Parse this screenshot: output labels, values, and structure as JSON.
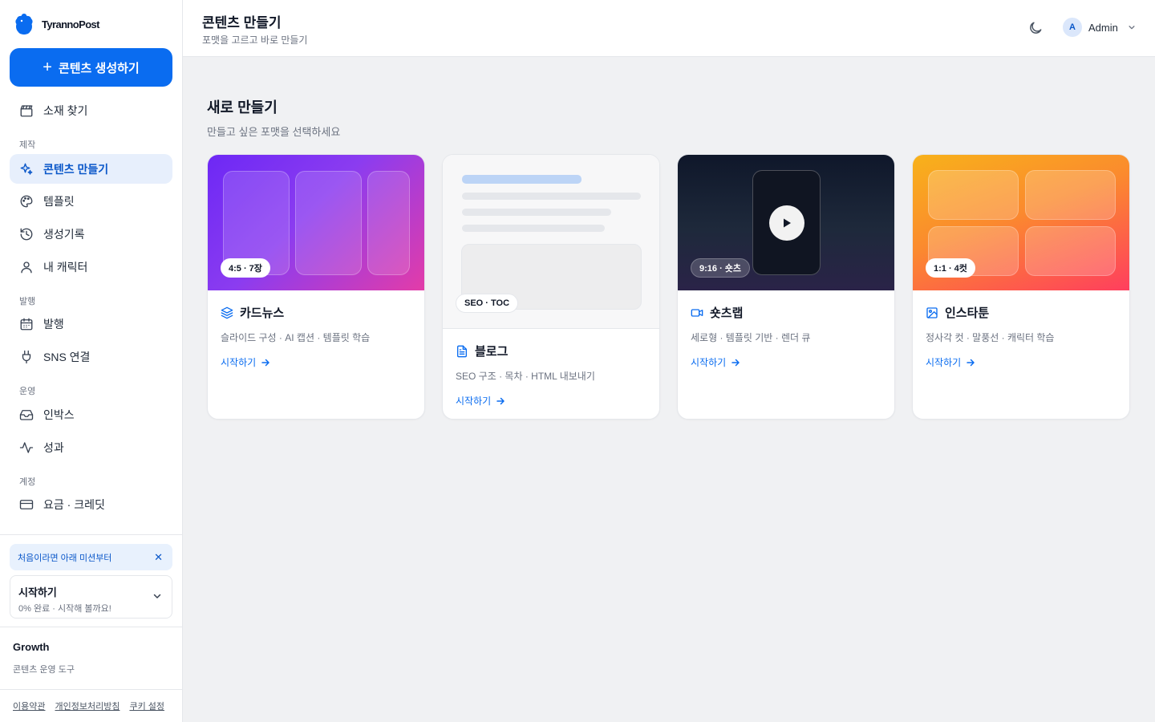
{
  "brand": {
    "name": "TyrannoPost",
    "color": "#0a6cf0"
  },
  "sidebar": {
    "create_label": "콘텐츠 생성하기",
    "items": [
      {
        "label": "소재 찾기",
        "icon": "clapperboard-icon"
      },
      {
        "label": "콘텐츠 만들기",
        "icon": "sparkles-icon",
        "active": true
      },
      {
        "label": "템플릿",
        "icon": "palette-icon"
      },
      {
        "label": "생성기록",
        "icon": "history-icon"
      },
      {
        "label": "내 캐릭터",
        "icon": "user-icon"
      },
      {
        "label": "발행",
        "icon": "calendar-icon"
      },
      {
        "label": "SNS 연결",
        "icon": "plug-icon"
      },
      {
        "label": "인박스",
        "icon": "inbox-icon"
      },
      {
        "label": "성과",
        "icon": "activity-icon"
      },
      {
        "label": "요금 · 크레딧",
        "icon": "credit-card-icon"
      }
    ],
    "sections": [
      "제작",
      "발행",
      "운영",
      "계정"
    ],
    "hint": "처음이라면 아래 미션부터",
    "mission": {
      "title": "시작하기",
      "subtitle": "0% 완료 · 시작해 볼까요!"
    },
    "plan": {
      "name": "Growth",
      "description": "콘텐츠 운영 도구"
    },
    "footer_links": [
      "이용약관",
      "개인정보처리방침",
      "쿠키 설정"
    ]
  },
  "header": {
    "title": "콘텐츠 만들기",
    "subtitle": "포맷을 고르고 바로 만들기",
    "user": {
      "initial": "A",
      "name": "Admin"
    }
  },
  "main": {
    "section_title": "새로 만들기",
    "section_subtitle": "만들고 싶은 포맷을 선택하세요",
    "cards": [
      {
        "badge": "4:5 · 7장",
        "title": "카드뉴스",
        "icon": "layers-icon",
        "description": "슬라이드 구성 · AI 캡션 · 템플릿 학습",
        "cta": "시작하기"
      },
      {
        "badge": "SEO · TOC",
        "title": "블로그",
        "icon": "document-icon",
        "description": "SEO 구조 · 목차 · HTML 내보내기",
        "cta": "시작하기"
      },
      {
        "badge": "9:16 · 숏츠",
        "title": "숏츠랩",
        "icon": "video-icon",
        "description": "세로형 · 템플릿 기반 · 렌더 큐",
        "cta": "시작하기"
      },
      {
        "badge": "1:1 · 4컷",
        "title": "인스타툰",
        "icon": "image-icon",
        "description": "정사각 컷 · 말풍선 · 캐릭터 학습",
        "cta": "시작하기"
      }
    ]
  }
}
